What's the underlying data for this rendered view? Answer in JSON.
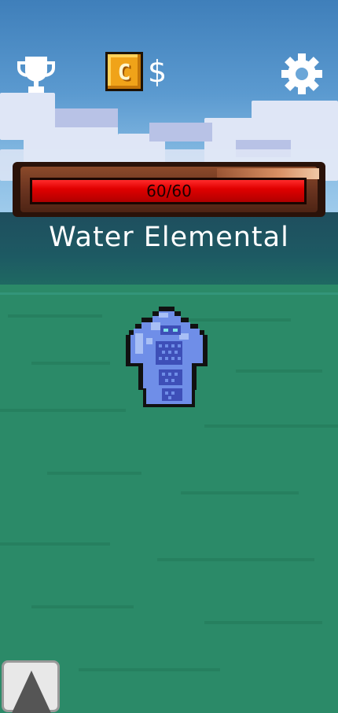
{
  "hud": {
    "leaderboard_icon": "trophy-icon",
    "coin_icon": "coin-icon",
    "coin_letter": "C",
    "currency_symbol": "$",
    "settings_icon": "gear-icon"
  },
  "enemy": {
    "name": "Water Elemental",
    "hp_current": 60,
    "hp_max": 60,
    "hp_text": "60/60",
    "hp_fraction": 1.0,
    "sprite": "water-elemental-sprite"
  },
  "controls": {
    "up_button_icon": "up-arrow-icon"
  },
  "colors": {
    "hp_fill": "#e00000",
    "grass": "#2b8a68",
    "coin": "#f0a319"
  }
}
